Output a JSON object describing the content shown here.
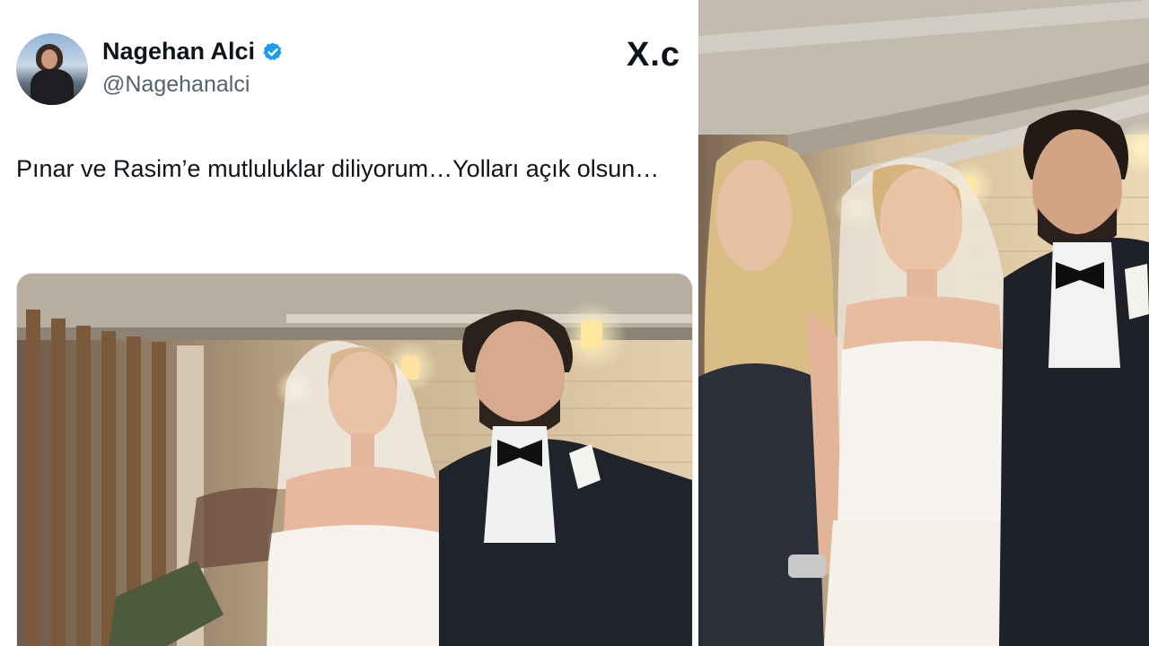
{
  "tweet": {
    "display_name": "Nagehan Alci",
    "handle": "@Nagehanalci",
    "text": "Pınar ve Rasim’e mutluluklar diliyorum…Yolları açık olsun…",
    "verified": true,
    "icons": [
      "avatar",
      "verified-badge-icon",
      "x-logo"
    ],
    "colors": {
      "verified": "#1d9bf0",
      "name": "#0f1419",
      "handle": "#536471"
    }
  },
  "watermark": {
    "text": "X.c"
  }
}
